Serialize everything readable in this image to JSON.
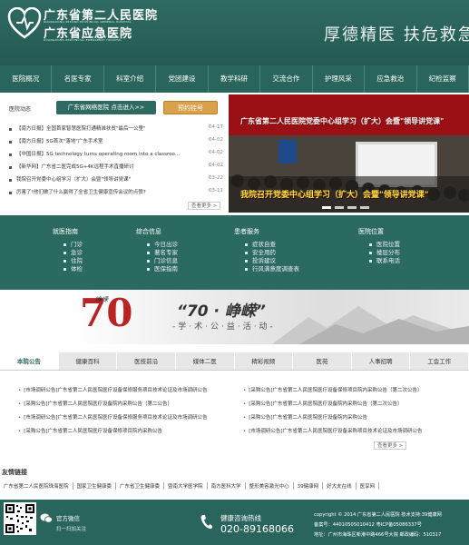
{
  "header": {
    "logo_line1": "广东省第二人民医院",
    "logo_line1_en": "GUANGDONG SECOND PROVINCIAL GENERAL HOSPITAL",
    "logo_line2": "广东省应急医院",
    "logo_line2_en": "GUANGDONG PROVINCIAL EMERGENCY HOSPITAL",
    "slogan": "厚德精医 扶危救急"
  },
  "nav": {
    "items": [
      "医院概况",
      "名医专家",
      "科室介绍",
      "党团建设",
      "教学科研",
      "交流合作",
      "护理风采",
      "应急救治",
      "纪检监察"
    ]
  },
  "news": {
    "title": "医院动态",
    "wechat_button": "广东省网络医院 点击进入>>",
    "booking_button": "预约挂号",
    "items": [
      {
        "text": "【南方日报】全国首家智慧医院打通精准扶贫\"最后一公里\"",
        "date": "04-17"
      },
      {
        "text": "【南方日报】5G首次\"落地\"广东手术室",
        "date": "04-02"
      },
      {
        "text": "【中国日报】5G technology turns operating room into a classroo...",
        "date": "04-02"
      },
      {
        "text": "【新华网】广东省二医完成5G+4K远程手术直播研讨",
        "date": "04-02"
      },
      {
        "text": "我院召开党委中心组学习（扩大）会暨\"领导讲党课\"",
        "date": "03-22"
      },
      {
        "text": "厉害了!他们做了什么赢得了全省卫生健康宣传会议的点赞?",
        "date": "03-11"
      }
    ],
    "more": "查看更多 >"
  },
  "banner": {
    "top_text": "广东省第二人民医院党委中心组学习（扩大）会暨\"领导讲党课\"",
    "caption": "我院召开党委中心组学习（扩大）会暨\"领导讲党课\""
  },
  "services": [
    {
      "title": "就医指南",
      "items": [
        "门诊",
        "急诊",
        "住院",
        "体检"
      ]
    },
    {
      "title": "综合信息",
      "items": [
        "今日出诊",
        "著名专家",
        "门诊信息",
        "医保指南"
      ]
    },
    {
      "title": "患者服务",
      "items": [
        "症状自查",
        "安全用药",
        "投诉建议",
        "行风满意度调查表"
      ]
    },
    {
      "title": "医院位置",
      "items": [
        "医院位置",
        "楼层分布",
        "联系电话"
      ]
    }
  ],
  "anniversary": {
    "number": "70",
    "subtitle": "峥嵘",
    "title_quote": "“70 · 峥嵘”",
    "tagline": "-学·术·公·益·活·动-"
  },
  "tabs": {
    "labels": [
      "本院公告",
      "健康百科",
      "医技前沿",
      "媒体二医",
      "精彩视频",
      "医苑",
      "人事招聘",
      "工会工作"
    ],
    "active": 0,
    "left_items": [
      "[市场调研公告]广东省第二人民医院医疗设备保修服务项目技术论证及市场调研公告",
      "[采购公告]广东省第二人民医院医疗设备院内采购公告（第二公告）",
      "[市场调研公告]广东省第二人民医院医疗设备保修服务项目技术论证及市场调研公告",
      "[采购公告]广东省第二人民医院医疗设备保修项目院内采购公告"
    ],
    "right_items": [
      "[采购公告]广东省第二人民医院医疗设备保修项目院内采购公告（第二次公告）",
      "[采购公告]广东省第二人民医院医疗设备院内采购公告（第二次公告）",
      "[采购公告]广东省第二人民医院医疗设备院内采购公告",
      "[市场调研公告]广东省第二人民医院医疗设备采购项目技术论证及市场调研公告"
    ],
    "more": "查看更多 >"
  },
  "links": {
    "title": "友情链接",
    "items": [
      "广东省第二人民医院珠海医院",
      "国家卫生健康委",
      "广东省卫生健康委",
      "暨南大学医学院",
      "南方医科大学",
      "整形美容激光中心",
      "39健康网",
      "好大夫在线",
      "医享网"
    ]
  },
  "footer": {
    "wechat_label": "官方微信",
    "wechat_sub": "扫一扫加关注",
    "hotline_label": "健康咨询热线",
    "hotline_number": "020-89168066",
    "copyright": "copyright © 2014 广东省第二人民医院 技术支持:39健康网",
    "icp": "备案号：44010505010412 粤ICP备05086337号",
    "address": "地址：广州市海珠区新港中路466号大院 邮政编码：510317"
  },
  "colors": {
    "primary": "#2a655d",
    "accent_red": "#b82323",
    "banner_caption": "#ffe23a",
    "booking": "#d9a24a"
  }
}
